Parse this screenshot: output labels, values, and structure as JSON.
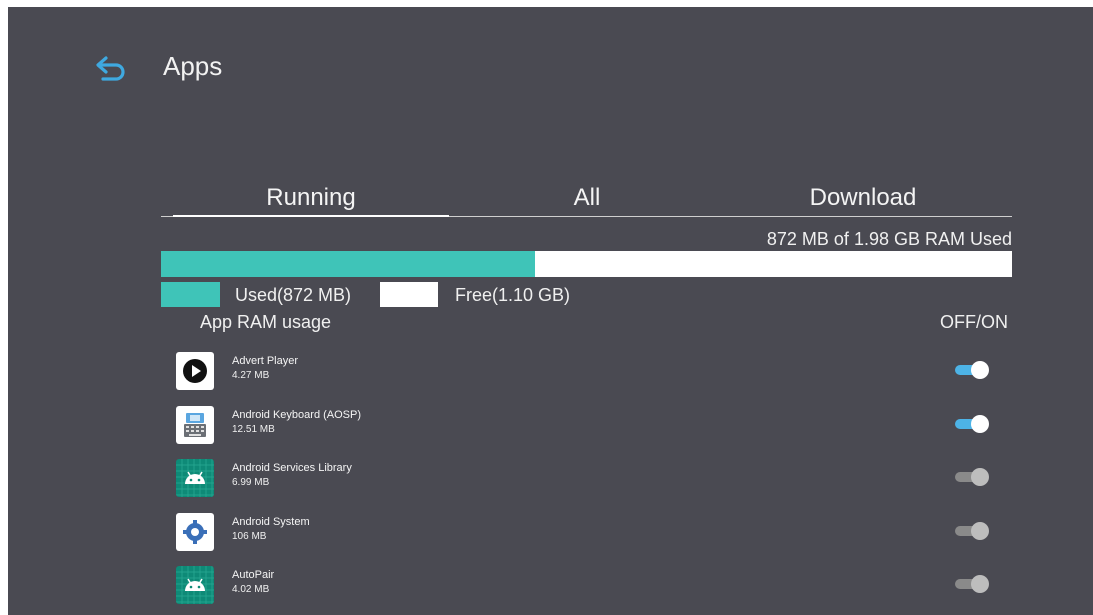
{
  "header": {
    "title": "Apps",
    "back_icon": "back-arrow-icon",
    "accent_color": "#3fa9e0"
  },
  "tabs": [
    {
      "label": "Running",
      "selected": true
    },
    {
      "label": "All",
      "selected": false
    },
    {
      "label": "Download",
      "selected": false
    }
  ],
  "ram": {
    "summary": "872 MB of 1.98 GB RAM Used",
    "used_fraction": 0.44,
    "used_label": "Used(872 MB)",
    "free_label": "Free(1.10 GB)",
    "used_color": "#3fc4b8",
    "free_color": "#ffffff"
  },
  "list_header": {
    "left_label": "App RAM usage",
    "right_label": "OFF/ON"
  },
  "apps": [
    {
      "name": "Advert Player",
      "size": "4.27 MB",
      "icon": "play-icon",
      "enabled": true
    },
    {
      "name": "Android Keyboard (AOSP)",
      "size": "12.51 MB",
      "icon": "keyboard-icon",
      "enabled": true
    },
    {
      "name": "Android Services Library",
      "size": "6.99 MB",
      "icon": "android-icon",
      "enabled": false
    },
    {
      "name": "Android System",
      "size": "106 MB",
      "icon": "gear-icon",
      "enabled": false
    },
    {
      "name": "AutoPair",
      "size": "4.02 MB",
      "icon": "android-icon",
      "enabled": false
    }
  ]
}
